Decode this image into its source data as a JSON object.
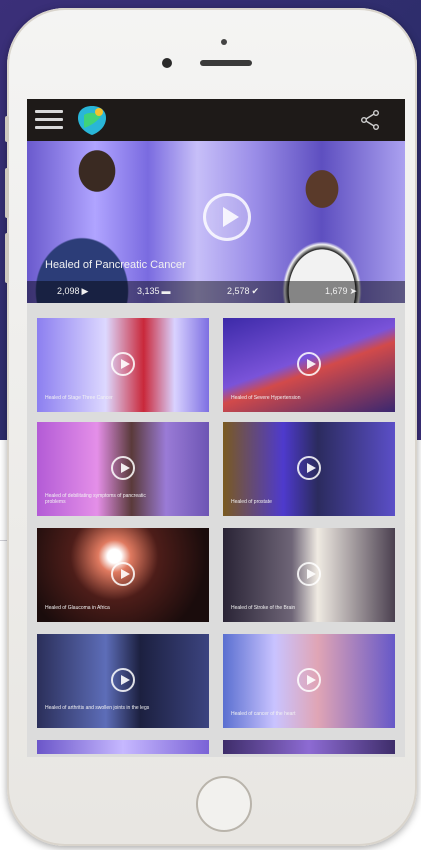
{
  "hero": {
    "title": "Healed of Pancreatic Cancer",
    "stats": [
      {
        "value": "2,098",
        "icon": "play-icon"
      },
      {
        "value": "3,135",
        "icon": "comment-icon"
      },
      {
        "value": "2,578",
        "icon": "check-icon"
      },
      {
        "value": "1,679",
        "icon": "share-icon"
      }
    ]
  },
  "tiles": [
    {
      "caption": "Healed of Stage Three Cancer"
    },
    {
      "caption": "Healed of Severe Hypertension"
    },
    {
      "caption": "Healed of debilitating symptoms of pancreatic problems"
    },
    {
      "caption": "Healed of prostate"
    },
    {
      "caption": "Healed of Glaucoma in Africa"
    },
    {
      "caption": "Healed of Stroke of the Brain"
    },
    {
      "caption": "Healed of arthritis and swollen joints in the legs"
    },
    {
      "caption": "Healed of cancer of the heart"
    },
    {
      "caption": ""
    },
    {
      "caption": ""
    }
  ],
  "icons": {
    "menu": "hamburger-menu-icon",
    "logo": "app-logo",
    "share": "share-icon"
  },
  "colors": {
    "topbar": "#1e1a18",
    "backdrop": "#3b2f79",
    "screen_bg": "#dcdcdc"
  }
}
